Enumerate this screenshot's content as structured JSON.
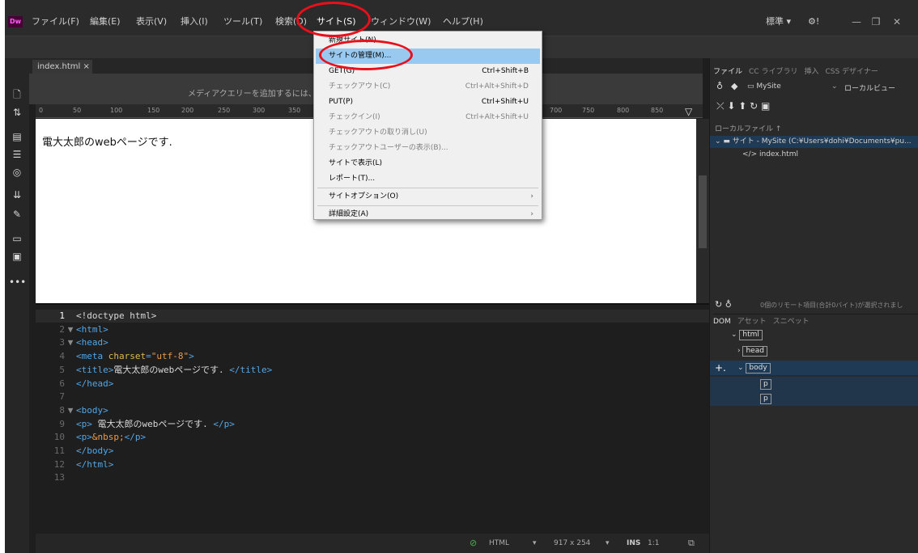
{
  "app": {
    "logo": "Dw"
  },
  "menu": {
    "items": [
      "ファイル(F)",
      "編集(E)",
      "表示(V)",
      "挿入(I)",
      "ツール(T)",
      "検索(D)",
      "サイト(S)",
      "ウィンドウ(W)",
      "ヘルプ(H)"
    ],
    "workspace": "標準 ▾",
    "sync_icon": "⚙!"
  },
  "doc": {
    "tab": "index.html ×",
    "media_hint": "メディアクエリーを追加するには、",
    "ruler_ticks": [
      "0",
      "50",
      "100",
      "150",
      "200",
      "250",
      "300",
      "350",
      "700",
      "750",
      "800",
      "850"
    ],
    "design_text": "電大太郎のwebページです."
  },
  "code": {
    "lines": [
      {
        "n": "1",
        "fold": "",
        "parts": [
          [
            "txt",
            "<!doctype html>"
          ]
        ]
      },
      {
        "n": "2",
        "fold": "▼",
        "parts": [
          [
            "tag",
            "<html>"
          ]
        ]
      },
      {
        "n": "3",
        "fold": "▼",
        "parts": [
          [
            "tag",
            "<head>"
          ]
        ]
      },
      {
        "n": "4",
        "fold": "",
        "parts": [
          [
            "tag",
            "<meta "
          ],
          [
            "attr",
            "charset"
          ],
          [
            "tag",
            "="
          ],
          [
            "val",
            "\"utf-8\""
          ],
          [
            "tag",
            ">"
          ]
        ]
      },
      {
        "n": "5",
        "fold": "",
        "parts": [
          [
            "tag",
            "<title>"
          ],
          [
            "txt",
            "電大太郎のwebページです. "
          ],
          [
            "tag",
            "</title>"
          ]
        ]
      },
      {
        "n": "6",
        "fold": "",
        "parts": [
          [
            "tag",
            "</head>"
          ]
        ]
      },
      {
        "n": "7",
        "fold": "",
        "parts": []
      },
      {
        "n": "8",
        "fold": "▼",
        "parts": [
          [
            "tag",
            "<body>"
          ]
        ]
      },
      {
        "n": "9",
        "fold": "",
        "parts": [
          [
            "tag",
            "<p>"
          ],
          [
            "txt",
            " 電大太郎のwebページです. "
          ],
          [
            "tag",
            "</p>"
          ]
        ]
      },
      {
        "n": "10",
        "fold": "",
        "parts": [
          [
            "tag",
            "<p>"
          ],
          [
            "ent",
            "&nbsp;"
          ],
          [
            "tag",
            "</p>"
          ]
        ]
      },
      {
        "n": "11",
        "fold": "",
        "parts": [
          [
            "tag",
            "</body>"
          ]
        ]
      },
      {
        "n": "12",
        "fold": "",
        "parts": [
          [
            "tag",
            "</html>"
          ]
        ]
      },
      {
        "n": "13",
        "fold": "",
        "parts": []
      }
    ]
  },
  "status": {
    "lang": "HTML",
    "size": "917 x 254",
    "mode": "INS",
    "pos": "1:1"
  },
  "files_panel": {
    "tabs": [
      "ファイル",
      "CC ライブラリ",
      "挿入",
      "CSS デザイナー"
    ],
    "site_select": "MySite",
    "view_select": "ローカルビュー",
    "local_files": "ローカルファイル ↑",
    "site_row": "サイト - MySite (C:¥Users¥dohi¥Documents¥pu...",
    "file_row": "index.html",
    "remote_info": "0個のリモート項目(合計0バイト)が選択されまし"
  },
  "dom_panel": {
    "tabs": [
      "DOM",
      "アセット",
      "スニペット"
    ],
    "nodes": [
      "html",
      "head",
      "body",
      "p",
      "p"
    ]
  },
  "site_menu": {
    "items": [
      {
        "label": "新規サイト(N)...",
        "shortcut": "",
        "disabled": false,
        "highlight": false,
        "arrow": false
      },
      {
        "label": "サイトの管理(M)...",
        "shortcut": "",
        "disabled": false,
        "highlight": true,
        "arrow": false
      },
      {
        "label": "GET(G)",
        "shortcut": "Ctrl+Shift+B",
        "disabled": false,
        "highlight": false,
        "arrow": false
      },
      {
        "label": "チェックアウト(C)",
        "shortcut": "Ctrl+Alt+Shift+D",
        "disabled": true,
        "highlight": false,
        "arrow": false
      },
      {
        "label": "PUT(P)",
        "shortcut": "Ctrl+Shift+U",
        "disabled": false,
        "highlight": false,
        "arrow": false
      },
      {
        "label": "チェックイン(I)",
        "shortcut": "Ctrl+Alt+Shift+U",
        "disabled": true,
        "highlight": false,
        "arrow": false
      },
      {
        "label": "チェックアウトの取り消し(U)",
        "shortcut": "",
        "disabled": true,
        "highlight": false,
        "arrow": false
      },
      {
        "label": "チェックアウトユーザーの表示(B)...",
        "shortcut": "",
        "disabled": true,
        "highlight": false,
        "arrow": false
      },
      {
        "label": "サイトで表示(L)",
        "shortcut": "",
        "disabled": false,
        "highlight": false,
        "arrow": false
      },
      {
        "label": "レポート(T)...",
        "shortcut": "",
        "disabled": false,
        "highlight": false,
        "arrow": false
      },
      {
        "label": "サイトオプション(O)",
        "shortcut": "",
        "disabled": false,
        "highlight": false,
        "arrow": true
      },
      {
        "label": "詳細設定(A)",
        "shortcut": "",
        "disabled": false,
        "highlight": false,
        "arrow": true
      }
    ]
  }
}
